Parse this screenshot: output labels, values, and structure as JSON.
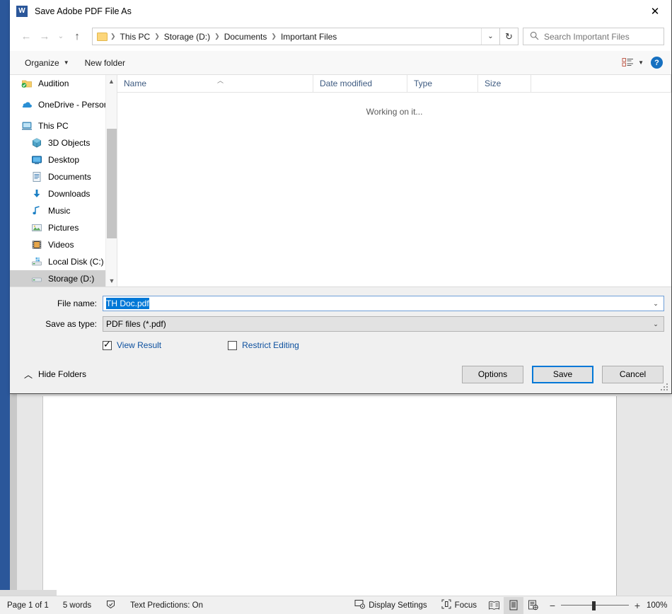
{
  "dialog": {
    "title": "Save Adobe PDF File As",
    "app_icon": "word-icon",
    "close": "✕",
    "nav": {
      "back": "←",
      "forward": "→",
      "recent": "⌄",
      "up": "↑",
      "dropdown": "⌄",
      "refresh": "↻"
    },
    "breadcrumbs": [
      "This PC",
      "Storage (D:)",
      "Documents",
      "Important Files"
    ],
    "search": {
      "placeholder": "Search Important Files",
      "icon": "search-icon"
    },
    "commandbar": {
      "organize": "Organize",
      "new_folder": "New folder",
      "view_icon": "list-view-icon",
      "help": "?"
    },
    "sidebar": {
      "items": [
        {
          "label": "Audition",
          "icon": "folder-sync-icon",
          "indent": false,
          "selected": false
        },
        {
          "label": "OneDrive - Person",
          "icon": "onedrive-icon",
          "indent": false,
          "selected": false
        },
        {
          "label": "This PC",
          "icon": "computer-icon",
          "indent": false,
          "selected": false
        },
        {
          "label": "3D Objects",
          "icon": "3d-objects-icon",
          "indent": true,
          "selected": false
        },
        {
          "label": "Desktop",
          "icon": "desktop-icon",
          "indent": true,
          "selected": false
        },
        {
          "label": "Documents",
          "icon": "documents-icon",
          "indent": true,
          "selected": false
        },
        {
          "label": "Downloads",
          "icon": "downloads-icon",
          "indent": true,
          "selected": false
        },
        {
          "label": "Music",
          "icon": "music-icon",
          "indent": true,
          "selected": false
        },
        {
          "label": "Pictures",
          "icon": "pictures-icon",
          "indent": true,
          "selected": false
        },
        {
          "label": "Videos",
          "icon": "videos-icon",
          "indent": true,
          "selected": false
        },
        {
          "label": "Local Disk (C:)",
          "icon": "local-disk-icon",
          "indent": true,
          "selected": false
        },
        {
          "label": "Storage (D:)",
          "icon": "drive-icon",
          "indent": true,
          "selected": true
        }
      ]
    },
    "columns": [
      "Name",
      "Date modified",
      "Type",
      "Size"
    ],
    "filelist_status": "Working on it...",
    "form": {
      "filename_label": "File name:",
      "filename_value": "TH Doc.pdf",
      "savetype_label": "Save as type:",
      "savetype_value": "PDF files (*.pdf)",
      "view_result": {
        "label": "View Result",
        "checked": true
      },
      "restrict_editing": {
        "label": "Restrict Editing",
        "checked": false
      }
    },
    "footer": {
      "hide_folders": "Hide Folders",
      "options": "Options",
      "save": "Save",
      "cancel": "Cancel",
      "accent": "#0078d7"
    }
  },
  "statusbar": {
    "page": "Page 1 of 1",
    "words": "5 words",
    "proofing_icon": "proofing-icon",
    "text_predictions": "Text Predictions: On",
    "display_settings": "Display Settings",
    "focus": "Focus",
    "views": [
      {
        "name": "read-mode-view",
        "icon": "book-icon",
        "active": false
      },
      {
        "name": "print-layout-view",
        "icon": "page-icon",
        "active": true
      },
      {
        "name": "web-layout-view",
        "icon": "web-icon",
        "active": false
      }
    ],
    "zoom_out": "−",
    "zoom_in": "+",
    "zoom_value": "100%"
  }
}
